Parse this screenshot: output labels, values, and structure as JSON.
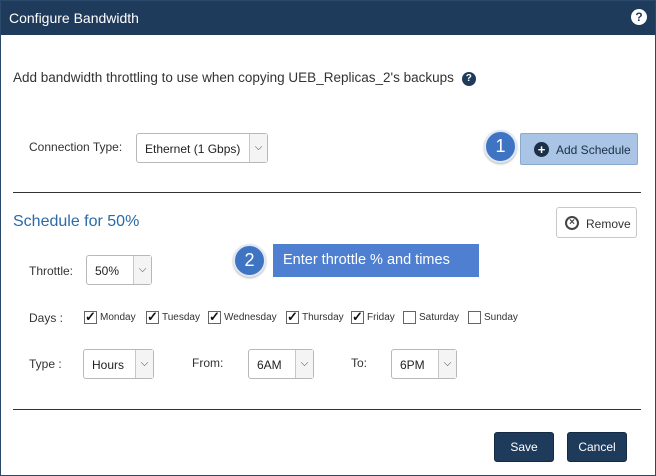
{
  "dialog": {
    "title": "Configure Bandwidth",
    "help_glyph": "?",
    "description": "Add bandwidth throttling to use when copying UEB_Replicas_2's backups",
    "colors": {
      "titlebar": "#1f3b5c",
      "accent": "#2a6aa8",
      "callout": "#4f7fd0"
    }
  },
  "connection": {
    "label": "Connection Type:",
    "selected": "Ethernet (1 Gbps)"
  },
  "add_schedule": {
    "label": "Add Schedule",
    "icon": "plus-circle-icon"
  },
  "callouts": [
    {
      "number": "1"
    },
    {
      "number": "2",
      "text": "Enter throttle % and times"
    }
  ],
  "schedule": {
    "title": "Schedule for 50%",
    "remove_label": "Remove",
    "throttle_label": "Throttle:",
    "throttle_value": "50%",
    "days_label": "Days :",
    "days": [
      {
        "label": "Monday",
        "checked": true
      },
      {
        "label": "Tuesday",
        "checked": true
      },
      {
        "label": "Wednesday",
        "checked": true
      },
      {
        "label": "Thursday",
        "checked": true
      },
      {
        "label": "Friday",
        "checked": true
      },
      {
        "label": "Saturday",
        "checked": false
      },
      {
        "label": "Sunday",
        "checked": false
      }
    ],
    "type_label": "Type :",
    "type_value": "Hours",
    "from_label": "From:",
    "from_value": "6AM",
    "to_label": "To:",
    "to_value": "6PM"
  },
  "footer": {
    "save_label": "Save",
    "cancel_label": "Cancel"
  }
}
